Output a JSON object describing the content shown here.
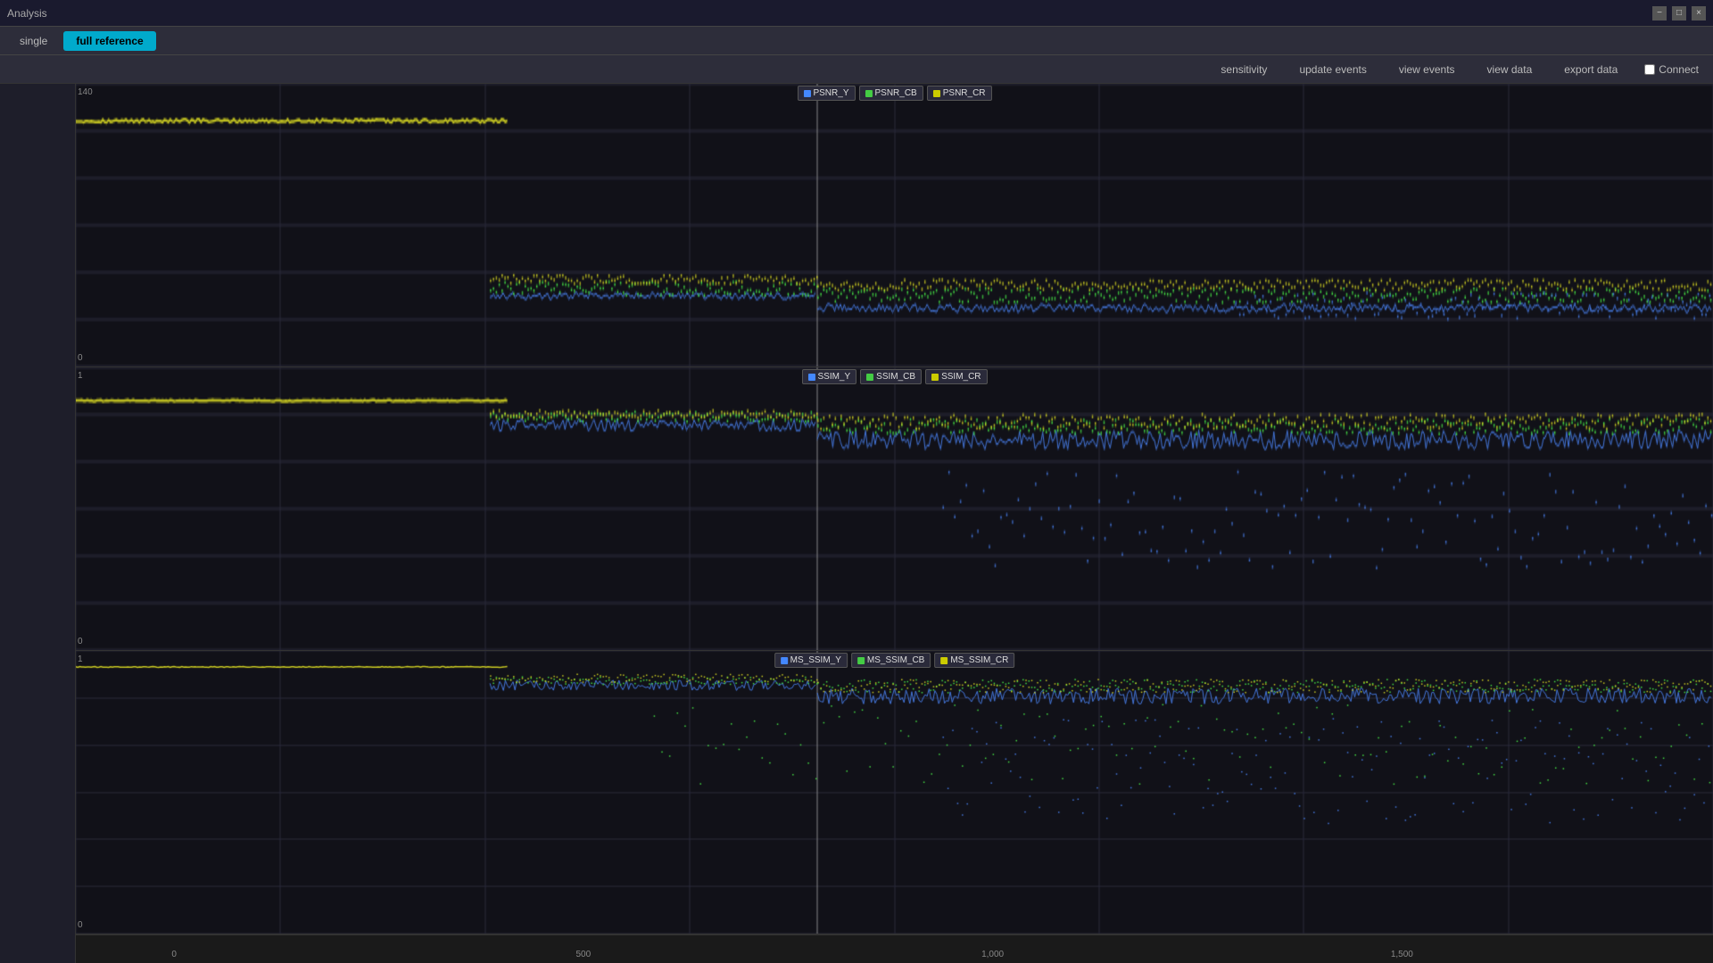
{
  "titlebar": {
    "title": "Analysis",
    "win_min": "−",
    "win_max": "□",
    "win_close": "×"
  },
  "tabs": {
    "single_label": "single",
    "full_reference_label": "full reference"
  },
  "toolbar": {
    "sensitivity_label": "sensitivity",
    "update_events_label": "update events",
    "view_events_label": "view events",
    "view_data_label": "view data",
    "export_data_label": "export data",
    "connect_label": "Connect"
  },
  "charts": {
    "psnr": {
      "y_max": "140",
      "y_min": "0",
      "legend": [
        {
          "id": "psnr_y",
          "label": "PSNR_Y",
          "color": "#4488ff"
        },
        {
          "id": "psnr_cb",
          "label": "PSNR_CB",
          "color": "#44cc44"
        },
        {
          "id": "psnr_cr",
          "label": "PSNR_CR",
          "color": "#cccc00"
        }
      ]
    },
    "ssim": {
      "y_max": "1",
      "y_min": "0",
      "legend": [
        {
          "id": "ssim_y",
          "label": "SSIM_Y",
          "color": "#4488ff"
        },
        {
          "id": "ssim_cb",
          "label": "SSIM_CB",
          "color": "#44cc44"
        },
        {
          "id": "ssim_cr",
          "label": "SSIM_CR",
          "color": "#cccc00"
        }
      ]
    },
    "ms_ssim": {
      "y_max": "1",
      "y_min": "0",
      "legend": [
        {
          "id": "ms_ssim_y",
          "label": "MS_SSIM_Y",
          "color": "#4488ff"
        },
        {
          "id": "ms_ssim_cb",
          "label": "MS_SSIM_CB",
          "color": "#44cc44"
        },
        {
          "id": "ms_ssim_cr",
          "label": "MS_SSIM_CR",
          "color": "#cccc00"
        }
      ]
    }
  },
  "xaxis": {
    "ticks": [
      "0",
      "500",
      "1,000",
      "1,500"
    ]
  }
}
